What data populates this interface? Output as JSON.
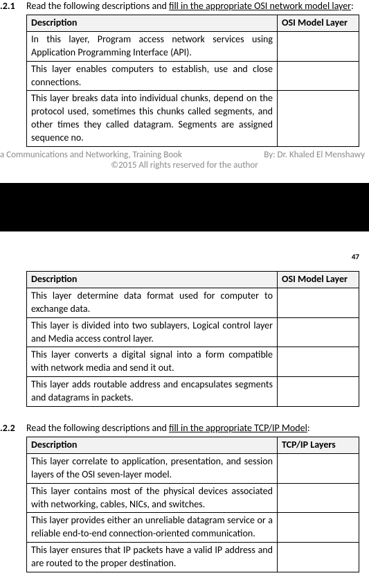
{
  "section1": {
    "number": ".2.1",
    "text_pre": "Read the following descriptions and ",
    "text_ul": "fill in the appropriate OSI network model layer",
    "text_post": ":"
  },
  "table1a": {
    "head_desc": "Description",
    "head_layer": "OSI Model Layer",
    "rows": [
      "In this layer, Program access network services using Application Programming Interface (API).",
      "This layer enables computers to establish, use and close connections.",
      "This layer breaks data into individual chunks, depend on the protocol used, sometimes this chunks called segments, and other times they called datagram. Segments are assigned sequence no."
    ]
  },
  "footer": {
    "left": "a Communications and Networking, Training Book",
    "right": "By: Dr. Khaled El Menshawy",
    "center": "©2015 All rights reserved for the author"
  },
  "page_number": "47",
  "table1b": {
    "head_desc": "Description",
    "head_layer": "OSI Model Layer",
    "rows": [
      "This layer determine data format used for computer to exchange data.",
      "This layer is divided into two sublayers, Logical control layer and Media access control layer.",
      "This layer converts a digital signal into a form compatible with network media and send it out.",
      "This layer adds routable address and encapsulates segments and datagrams in packets."
    ]
  },
  "section2": {
    "number": ".2.2",
    "text_pre": "Read the following descriptions and ",
    "text_ul": "fill in the appropriate TCP/IP Model",
    "text_post": ":"
  },
  "table2": {
    "head_desc": "Description",
    "head_layer": "TCP/IP Layers",
    "rows": [
      "This layer correlate to application, presentation, and session layers of the OSI seven-layer model.",
      "This layer contains most of the physical devices associated with networking, cables, NICs, and switches.",
      "This layer provides either an unreliable datagram service or a reliable end-to-end connection-oriented communication.",
      "This layer ensures that IP packets have a valid IP address and are routed to the proper destination."
    ]
  }
}
